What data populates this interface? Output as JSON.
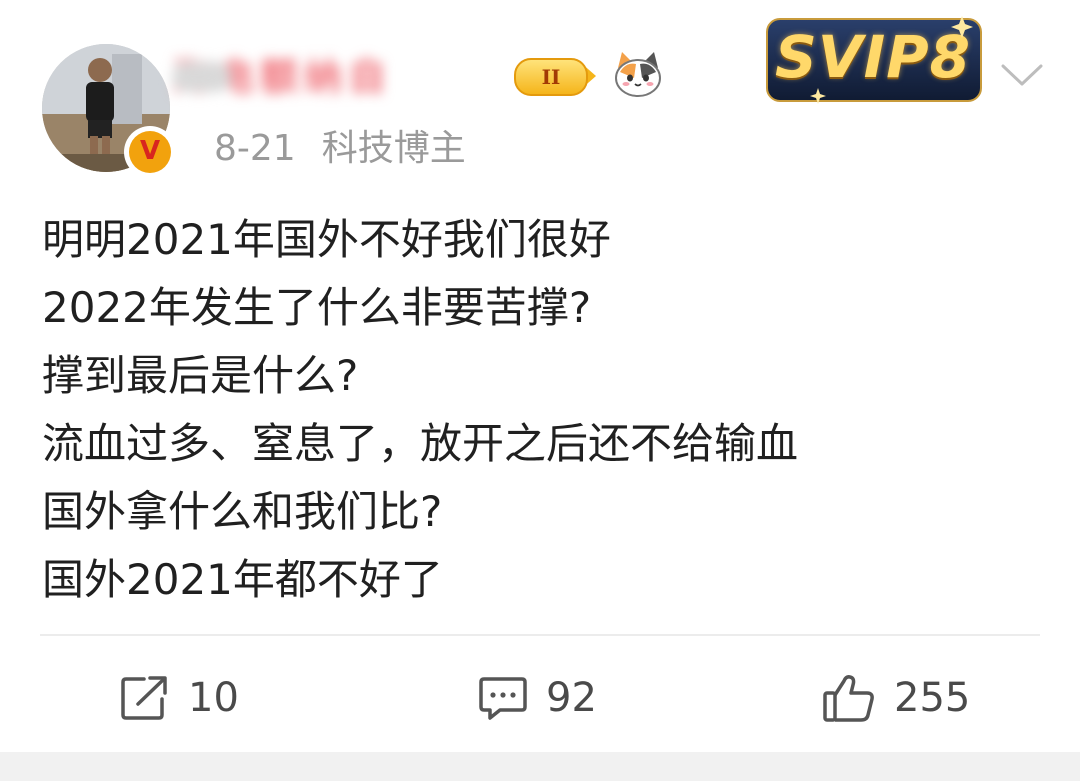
{
  "user": {
    "display_name": "海电额纳自",
    "level_badge": "II",
    "verified_badge": "V",
    "svip_label": "SVIP8"
  },
  "post": {
    "date": "8-21",
    "source": "科技博主",
    "lines": [
      "明明2021年国外不好我们很好",
      "2022年发生了什么非要苦撑?",
      "撑到最后是什么?",
      "流血过多、窒息了，放开之后还不给输血",
      "国外拿什么和我们比?",
      "国外2021年都不好了"
    ]
  },
  "actions": {
    "repost_count": "10",
    "comment_count": "92",
    "like_count": "255"
  },
  "colors": {
    "username": "#f0727a",
    "meta_text": "#9a9a9a",
    "body_text": "#202020",
    "svip_gold": "#ffd86a"
  },
  "icons": [
    "avatar",
    "verified-v-icon",
    "level-badge-icon",
    "cat-emoji-icon",
    "svip-badge-icon",
    "chevron-down-icon",
    "repost-icon",
    "comment-icon",
    "like-icon"
  ]
}
